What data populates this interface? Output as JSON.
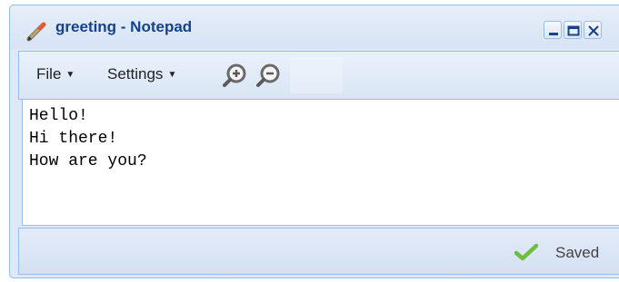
{
  "window": {
    "title": "greeting - Notepad",
    "icon": "pencil-icon",
    "controls": [
      "minimize-icon",
      "maximize-icon",
      "close-icon"
    ]
  },
  "toolbar": {
    "menus": [
      {
        "label": "File",
        "icon": "caret-down-icon"
      },
      {
        "label": "Settings",
        "icon": "caret-down-icon"
      }
    ],
    "zoom_in_icon": "zoom-in-icon",
    "zoom_out_icon": "zoom-out-icon"
  },
  "editor": {
    "content": "Hello!\nHi there!\nHow are you?"
  },
  "status": {
    "icon": "checkmark-icon",
    "text": "Saved",
    "icon_color": "#6cbf3c"
  },
  "colors": {
    "title_text": "#15428b",
    "border": "#99bbe8",
    "panel": "#dfe8f6"
  }
}
